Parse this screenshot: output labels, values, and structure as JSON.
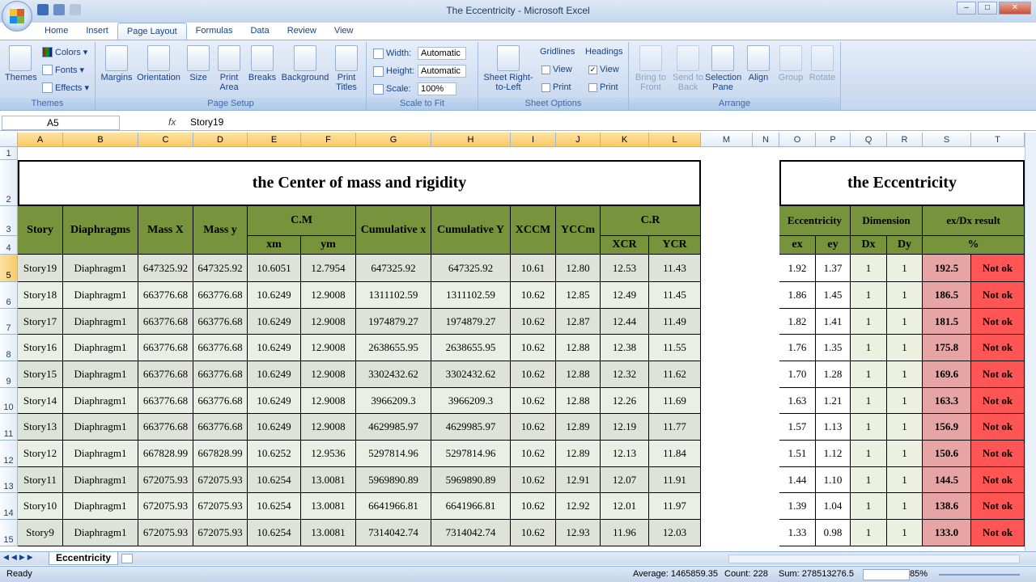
{
  "window": {
    "title": "The Eccentricity - Microsoft Excel",
    "min": "–",
    "max": "□",
    "close": "✕"
  },
  "tabs": [
    "Home",
    "Insert",
    "Page Layout",
    "Formulas",
    "Data",
    "Review",
    "View"
  ],
  "ribbon": {
    "themes": {
      "label": "Themes",
      "colors": "Colors",
      "fonts": "Fonts",
      "effects": "Effects",
      "group": "Themes"
    },
    "page_setup": {
      "margins": "Margins",
      "orientation": "Orientation",
      "size": "Size",
      "print_area": "Print Area",
      "breaks": "Breaks",
      "background": "Background",
      "print_titles": "Print Titles",
      "group": "Page Setup"
    },
    "scale_to_fit": {
      "width_label": "Width:",
      "width_value": "Automatic",
      "height_label": "Height:",
      "height_value": "Automatic",
      "scale_label": "Scale:",
      "scale_value": "100%",
      "group": "Scale to Fit"
    },
    "sheet_options": {
      "sheet_rtl": "Sheet Right-to-Left",
      "gridlines": "Gridlines",
      "headings": "Headings",
      "view": "View",
      "print": "Print",
      "group": "Sheet Options"
    },
    "arrange": {
      "bring_front": "Bring to Front",
      "send_back": "Send to Back",
      "selection_pane": "Selection Pane",
      "align": "Align",
      "group_btn": "Group",
      "rotate": "Rotate",
      "group": "Arrange"
    }
  },
  "formula": {
    "namebox": "A5",
    "fx": "fx",
    "content": "Story19"
  },
  "columns": [
    "A",
    "B",
    "C",
    "D",
    "E",
    "F",
    "G",
    "H",
    "I",
    "J",
    "K",
    "L",
    "M",
    "N",
    "O",
    "P",
    "Q",
    "R",
    "S",
    "T"
  ],
  "rows": [
    "1",
    "2",
    "3",
    "4",
    "5",
    "6",
    "7",
    "8",
    "9",
    "10",
    "11",
    "12",
    "13",
    "14",
    "15"
  ],
  "left_table": {
    "title": "the Center of mass and rigidity",
    "headers": {
      "story": "Story",
      "diaphragms": "Diaphragms",
      "mass_x": "Mass X",
      "mass_y": "Mass y",
      "cm": "C.M",
      "xm": "xm",
      "ym": "ym",
      "cum_x": "Cumulative x",
      "cum_y": "Cumulative Y",
      "xccm": "XCCM",
      "yccm": "YCCm",
      "cr": "C.R",
      "xcr": "XCR",
      "ycr": "YCR"
    },
    "data": [
      [
        "Story19",
        "Diaphragm1",
        "647325.92",
        "647325.92",
        "10.6051",
        "12.7954",
        "647325.92",
        "647325.92",
        "10.61",
        "12.80",
        "12.53",
        "11.43"
      ],
      [
        "Story18",
        "Diaphragm1",
        "663776.68",
        "663776.68",
        "10.6249",
        "12.9008",
        "1311102.59",
        "1311102.59",
        "10.62",
        "12.85",
        "12.49",
        "11.45"
      ],
      [
        "Story17",
        "Diaphragm1",
        "663776.68",
        "663776.68",
        "10.6249",
        "12.9008",
        "1974879.27",
        "1974879.27",
        "10.62",
        "12.87",
        "12.44",
        "11.49"
      ],
      [
        "Story16",
        "Diaphragm1",
        "663776.68",
        "663776.68",
        "10.6249",
        "12.9008",
        "2638655.95",
        "2638655.95",
        "10.62",
        "12.88",
        "12.38",
        "11.55"
      ],
      [
        "Story15",
        "Diaphragm1",
        "663776.68",
        "663776.68",
        "10.6249",
        "12.9008",
        "3302432.62",
        "3302432.62",
        "10.62",
        "12.88",
        "12.32",
        "11.62"
      ],
      [
        "Story14",
        "Diaphragm1",
        "663776.68",
        "663776.68",
        "10.6249",
        "12.9008",
        "3966209.3",
        "3966209.3",
        "10.62",
        "12.88",
        "12.26",
        "11.69"
      ],
      [
        "Story13",
        "Diaphragm1",
        "663776.68",
        "663776.68",
        "10.6249",
        "12.9008",
        "4629985.97",
        "4629985.97",
        "10.62",
        "12.89",
        "12.19",
        "11.77"
      ],
      [
        "Story12",
        "Diaphragm1",
        "667828.99",
        "667828.99",
        "10.6252",
        "12.9536",
        "5297814.96",
        "5297814.96",
        "10.62",
        "12.89",
        "12.13",
        "11.84"
      ],
      [
        "Story11",
        "Diaphragm1",
        "672075.93",
        "672075.93",
        "10.6254",
        "13.0081",
        "5969890.89",
        "5969890.89",
        "10.62",
        "12.91",
        "12.07",
        "11.91"
      ],
      [
        "Story10",
        "Diaphragm1",
        "672075.93",
        "672075.93",
        "10.6254",
        "13.0081",
        "6641966.81",
        "6641966.81",
        "10.62",
        "12.92",
        "12.01",
        "11.97"
      ],
      [
        "Story9",
        "Diaphragm1",
        "672075.93",
        "672075.93",
        "10.6254",
        "13.0081",
        "7314042.74",
        "7314042.74",
        "10.62",
        "12.93",
        "11.96",
        "12.03"
      ]
    ]
  },
  "right_table": {
    "title": "the Eccentricity",
    "headers": {
      "eccentricity": "Eccentricity",
      "dimension": "Dimension",
      "result": "ex/Dx result",
      "ex": "ex",
      "ey": "ey",
      "dx": "Dx",
      "dy": "Dy",
      "pct": "%"
    },
    "data": [
      [
        "1.92",
        "1.37",
        "1",
        "1",
        "192.5",
        "Not ok"
      ],
      [
        "1.86",
        "1.45",
        "1",
        "1",
        "186.5",
        "Not ok"
      ],
      [
        "1.82",
        "1.41",
        "1",
        "1",
        "181.5",
        "Not ok"
      ],
      [
        "1.76",
        "1.35",
        "1",
        "1",
        "175.8",
        "Not ok"
      ],
      [
        "1.70",
        "1.28",
        "1",
        "1",
        "169.6",
        "Not ok"
      ],
      [
        "1.63",
        "1.21",
        "1",
        "1",
        "163.3",
        "Not ok"
      ],
      [
        "1.57",
        "1.13",
        "1",
        "1",
        "156.9",
        "Not ok"
      ],
      [
        "1.51",
        "1.12",
        "1",
        "1",
        "150.6",
        "Not ok"
      ],
      [
        "1.44",
        "1.10",
        "1",
        "1",
        "144.5",
        "Not ok"
      ],
      [
        "1.39",
        "1.04",
        "1",
        "1",
        "138.6",
        "Not ok"
      ],
      [
        "1.33",
        "0.98",
        "1",
        "1",
        "133.0",
        "Not ok"
      ]
    ]
  },
  "sheet_tab": "Eccentricity",
  "status": {
    "ready": "Ready",
    "average": "Average: 1465859.35",
    "count": "Count: 228",
    "sum": "Sum: 278513276.5",
    "zoom": "85%"
  },
  "colors": {
    "header_green": "#77933c",
    "not_ok_red": "#ff5555",
    "pct_pink": "#e6a4a4"
  }
}
